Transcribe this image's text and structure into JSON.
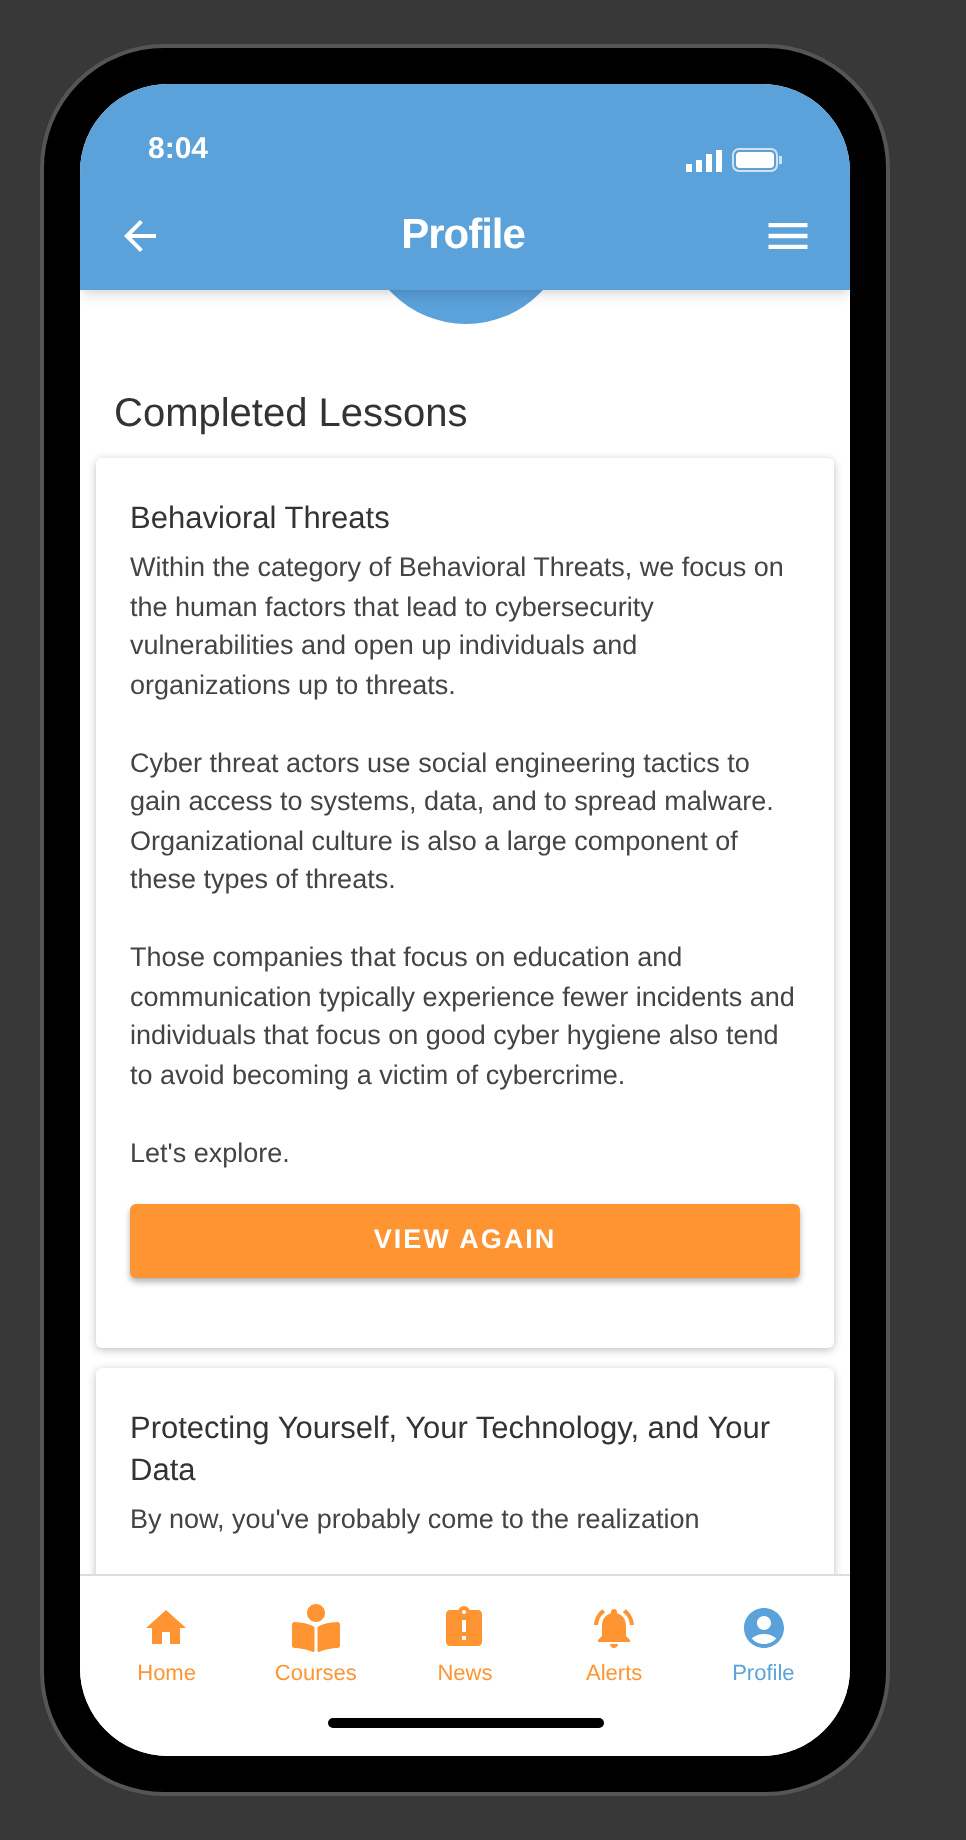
{
  "status_bar": {
    "time": "8:04"
  },
  "header": {
    "title": "Profile"
  },
  "section_title": "Completed Lessons",
  "lessons": [
    {
      "title": "Behavioral Threats",
      "paragraphs": [
        "Within the category of Behavioral Threats, we focus on the human factors that lead to cybersecurity vulnerabilities and open up individuals and organizations up to threats.",
        "Cyber threat actors use social engineering tactics to gain access to systems, data, and to spread malware.  Organizational culture is also a large component of these types of threats.",
        "Those companies that focus on education and communication typically experience fewer incidents and individuals that focus on good cyber hygiene also tend to avoid becoming a victim of cybercrime.",
        "Let's explore."
      ],
      "button": "VIEW AGAIN"
    },
    {
      "title": "Protecting Yourself, Your Technology, and Your Data",
      "paragraphs": [
        "By now, you've probably come to the realization"
      ]
    }
  ],
  "nav": [
    {
      "kind": "home",
      "label": "Home",
      "selected": false
    },
    {
      "kind": "courses",
      "label": "Courses",
      "selected": false
    },
    {
      "kind": "news",
      "label": "News",
      "selected": false
    },
    {
      "kind": "alerts",
      "label": "Alerts",
      "selected": false
    },
    {
      "kind": "profile",
      "label": "Profile",
      "selected": true
    }
  ]
}
